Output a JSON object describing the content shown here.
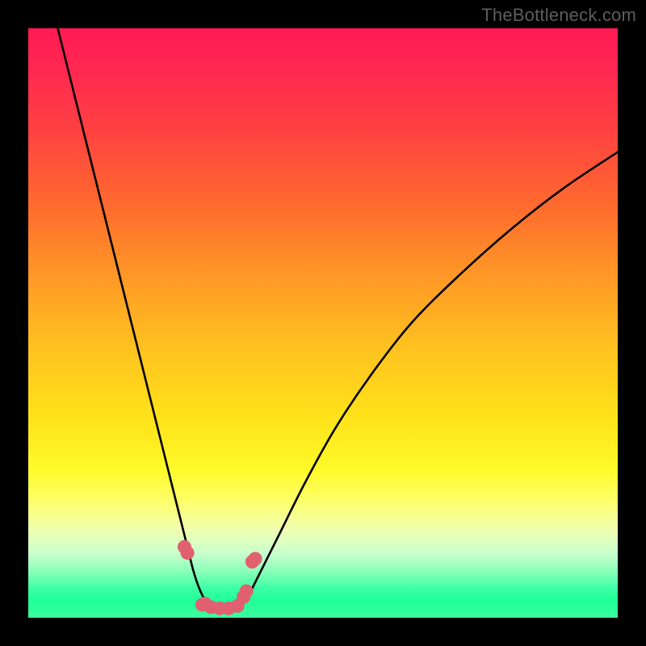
{
  "watermark": "TheBottleneck.com",
  "chart_data": {
    "type": "line",
    "title": "",
    "xlabel": "",
    "ylabel": "",
    "xlim": [
      0,
      100
    ],
    "ylim": [
      0,
      100
    ],
    "series": [
      {
        "name": "left-curve",
        "x": [
          5,
          7,
          9,
          11,
          13,
          15,
          17,
          19,
          21,
          23,
          25,
          26,
          27,
          28,
          29,
          30,
          31
        ],
        "values": [
          100,
          92,
          84,
          76,
          68,
          60,
          52,
          44,
          36,
          28,
          20,
          16,
          12,
          8,
          5,
          3,
          2
        ]
      },
      {
        "name": "right-curve",
        "x": [
          36,
          37,
          38,
          40,
          43,
          47,
          52,
          58,
          65,
          73,
          82,
          91,
          100
        ],
        "values": [
          2,
          3,
          5,
          9,
          15,
          23,
          32,
          41,
          50,
          58,
          66,
          73,
          79
        ]
      },
      {
        "name": "trough",
        "x": [
          31,
          33,
          35,
          36
        ],
        "values": [
          2,
          1.5,
          1.5,
          2
        ]
      }
    ],
    "markers": {
      "name": "highlight-points",
      "color": "#e06070",
      "points": [
        {
          "x": 26.5,
          "y": 12
        },
        {
          "x": 27.0,
          "y": 11
        },
        {
          "x": 29.5,
          "y": 2.2
        },
        {
          "x": 30.0,
          "y": 2.4
        },
        {
          "x": 31.0,
          "y": 1.8
        },
        {
          "x": 32.5,
          "y": 1.6
        },
        {
          "x": 34.0,
          "y": 1.6
        },
        {
          "x": 35.5,
          "y": 2.0
        },
        {
          "x": 36.5,
          "y": 3.5
        },
        {
          "x": 37.0,
          "y": 4.5
        },
        {
          "x": 38.0,
          "y": 9.5
        },
        {
          "x": 38.5,
          "y": 10.0
        }
      ]
    },
    "background_gradient": {
      "top": "#ff1a55",
      "mid1": "#ff9826",
      "mid2": "#fffa2a",
      "bottom": "#1fff98"
    }
  }
}
